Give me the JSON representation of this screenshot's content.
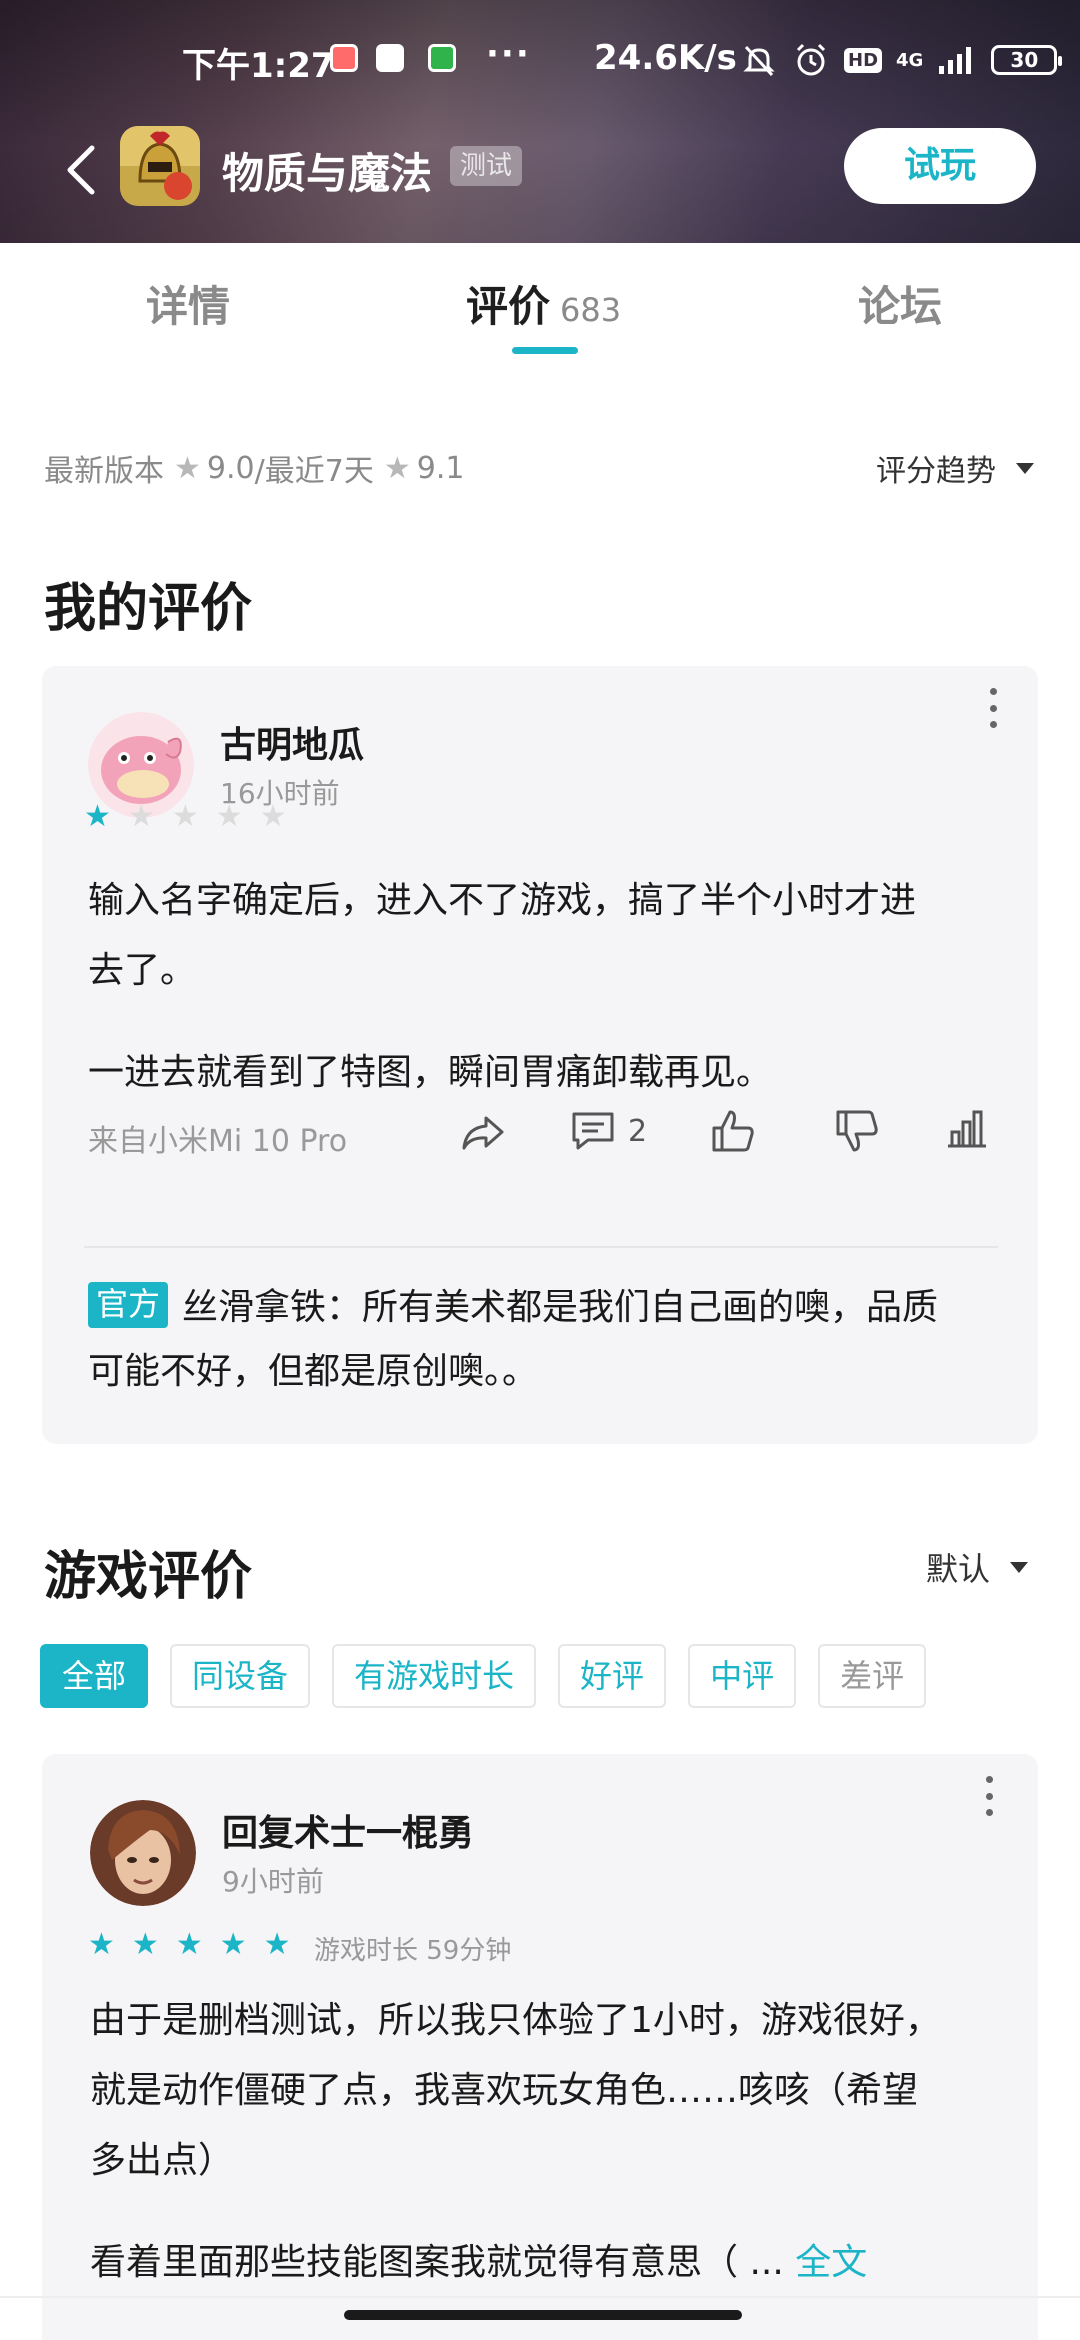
{
  "status_bar": {
    "time": "下午1:27",
    "dots": "···",
    "network_speed": "24.6K/s",
    "network_type": "4G",
    "hd": "HD",
    "battery": "30"
  },
  "header": {
    "app_title": "物质与魔法",
    "badge": "测试",
    "try_button": "试玩",
    "accent": "#1bb5c7"
  },
  "tabs": [
    {
      "label": "详情"
    },
    {
      "label": "评价",
      "count": "683"
    },
    {
      "label": "论坛"
    }
  ],
  "summary": {
    "latest_label": "最新版本",
    "latest_score": "9.0",
    "recent_label": "/最近7天",
    "recent_score": "9.1",
    "trend_label": "评分趋势"
  },
  "my_review": {
    "section_title": "我的评价",
    "user": "古明地瓜",
    "time_ago": "16小时前",
    "rating": 1,
    "paragraph1_line1": "输入名字确定后，进入不了游戏，搞了半个小时才进",
    "paragraph1_line2": "去了。",
    "paragraph2": "一进去就看到了特图，瞬间胃痛卸载再见。",
    "device": "来自小米Mi 10 Pro",
    "comment_count": "2",
    "official_badge": "官方",
    "official_reply_line1": "丝滑拿铁：所有美术都是我们自己画的噢，品质",
    "official_reply_line2": "可能不好，但都是原创噢。。"
  },
  "game_reviews": {
    "section_title": "游戏评价",
    "sort_label": "默认",
    "filters": [
      "全部",
      "同设备",
      "有游戏时长",
      "好评",
      "中评",
      "差评"
    ],
    "first": {
      "user": "回复术士一棍勇",
      "time_ago": "9小时前",
      "rating": 5,
      "playtime": "游戏时长 59分钟",
      "line1": "由于是删档测试，所以我只体验了1小时，游戏很好，",
      "line2": "就是动作僵硬了点，我喜欢玩女角色……咳咳（希望",
      "line3": "多出点）",
      "line4": "看着里面那些技能图案我就觉得有意思（ ... ",
      "full_text_link": "全文"
    }
  }
}
